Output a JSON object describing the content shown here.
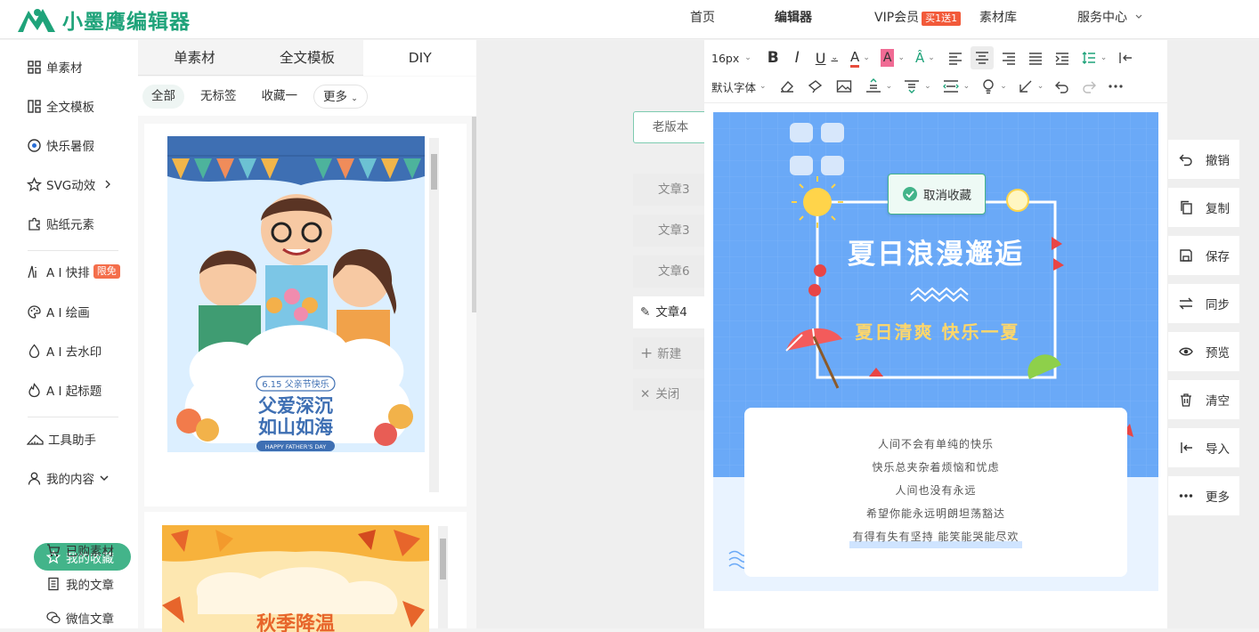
{
  "app": {
    "logo_text": "小墨鹰编辑器"
  },
  "topnav": {
    "home": "首页",
    "editor": "编辑器",
    "vip": "VIP会员",
    "vip_badge": "买1送1",
    "materials": "素材库",
    "service": "服务中心"
  },
  "sidebar": {
    "items": [
      {
        "label": "单素材",
        "icon": "grid-icon"
      },
      {
        "label": "全文模板",
        "icon": "template-icon"
      },
      {
        "label": "快乐暑假",
        "icon": "ball-icon"
      },
      {
        "label": "SVG动效",
        "icon": "star-icon"
      },
      {
        "label": "贴纸元素",
        "icon": "puzzle-icon"
      },
      {
        "label": "A I 快排",
        "icon": "ai-icon",
        "badge": "限免"
      },
      {
        "label": "A I 绘画",
        "icon": "palette-icon"
      },
      {
        "label": "A I 去水印",
        "icon": "drop-icon"
      },
      {
        "label": "A I 起标题",
        "icon": "flame-icon"
      },
      {
        "label": "工具助手",
        "icon": "ruler-icon"
      },
      {
        "label": "我的内容",
        "icon": "user-icon"
      }
    ],
    "sub_items": [
      "我的收藏",
      "已购素材",
      "我的文章",
      "微信文章"
    ]
  },
  "panel": {
    "tabs": [
      "单素材",
      "全文模板",
      "DIY"
    ],
    "filters": [
      "全部",
      "无标签",
      "收藏一",
      "更多"
    ],
    "card1": {
      "tag": "6.15 父亲节快乐",
      "title_line1": "父爱深沉",
      "title_line2": "如山如海",
      "sub": "HAPPY FATHER'S DAY"
    },
    "card2": {
      "title": "秋季降温"
    }
  },
  "editor": {
    "old_version": "老版本",
    "doc_tabs": [
      "文章3",
      "文章3",
      "文章6",
      "文章4"
    ],
    "new_label": "新建",
    "close_label": "关闭",
    "font_size": "16px",
    "font_family": "默认字体",
    "toast": "取消收藏",
    "poster": {
      "title": "夏日浪漫邂逅",
      "subtitle": "夏日清爽  快乐一夏",
      "lines": [
        "人间不会有单纯的快乐",
        "快乐总夹杂着烦恼和忧虑",
        "人间也没有永远",
        "希望你能永远明朗坦荡豁达",
        "有得有失有坚持 能笑能哭能尽欢"
      ]
    }
  },
  "actions": [
    "撤销",
    "复制",
    "保存",
    "同步",
    "预览",
    "清空",
    "导入",
    "更多"
  ],
  "colors": {
    "brand": "#1fa37a",
    "active": "#43b48a",
    "poster_blue": "#6aa9f7",
    "poster_yellow": "#ffd76a"
  }
}
